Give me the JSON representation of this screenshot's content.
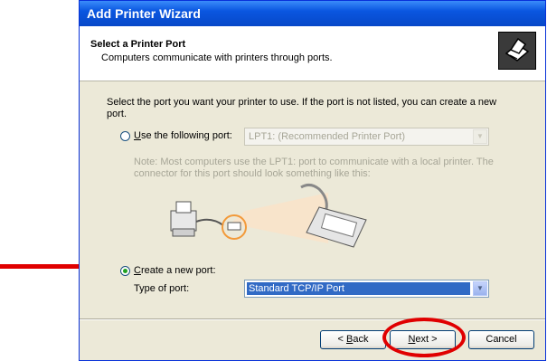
{
  "window": {
    "title": "Add Printer Wizard"
  },
  "header": {
    "title": "Select a Printer Port",
    "subtitle": "Computers communicate with printers through ports.",
    "icon": "printer-icon"
  },
  "intro": "Select the port you want your printer to use.  If the port is not listed, you can create a new port.",
  "use_port": {
    "label_u": "U",
    "label_rest": "se the following port:",
    "selected": false,
    "value": "LPT1: (Recommended Printer Port)"
  },
  "note": "Note: Most computers use the LPT1: port to communicate with a local printer. The connector for this port should look something like this:",
  "create_port": {
    "label_c": "C",
    "label_rest": "reate a new port:",
    "selected": true,
    "type_label": "Type of port:",
    "value": "Standard TCP/IP Port"
  },
  "buttons": {
    "back_lt": "< ",
    "back_u": "B",
    "back_rest": "ack",
    "next_u": "N",
    "next_rest": "ext >",
    "cancel": "Cancel"
  },
  "colors": {
    "annotation": "#e00000",
    "selection": "#316ac5",
    "titlebar": "#0a56e0"
  }
}
